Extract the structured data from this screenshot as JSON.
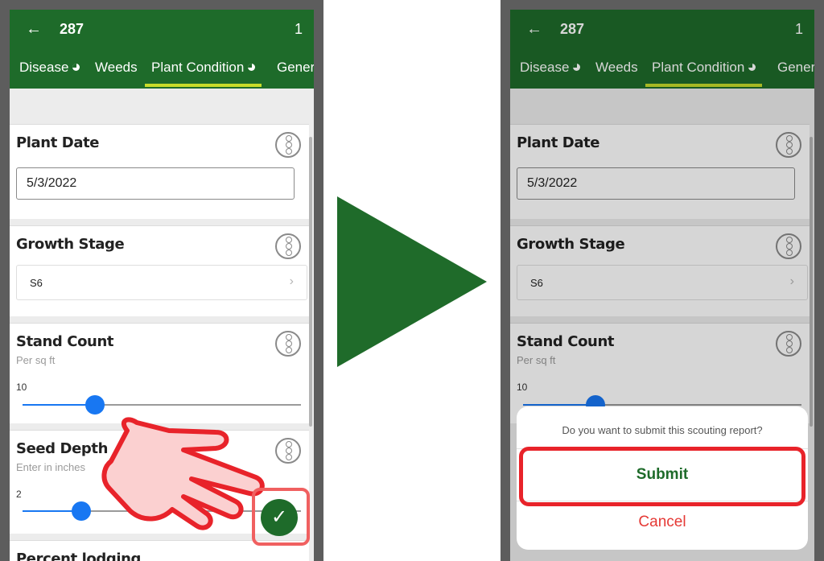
{
  "appbar": {
    "back_icon": "arrow-left-icon",
    "title": "287",
    "count": "1"
  },
  "tabs": [
    "Disease",
    "Weeds",
    "Plant Condition",
    "Gener"
  ],
  "active_tab": "Plant Condition",
  "fields": {
    "plant_date": {
      "label": "Plant Date",
      "value": "5/3/2022"
    },
    "growth_stage": {
      "label": "Growth Stage",
      "value": "S6"
    },
    "stand_count": {
      "label": "Stand Count",
      "hint": "Per sq ft",
      "value": "10"
    },
    "seed_depth": {
      "label": "Seed Depth",
      "hint": "Enter in inches",
      "value": "2"
    },
    "next_partial": {
      "label": "Percent lodging"
    }
  },
  "slider_levels": {
    "stand_count": 0.26,
    "seed_depth": 0.21
  },
  "fab": {
    "icon": "check-icon"
  },
  "dialog": {
    "message": "Do you want to submit this scouting report?",
    "submit_label": "Submit",
    "cancel_label": "Cancel"
  },
  "colors": {
    "brand_green": "#1e6b2a",
    "tab_indicator": "#c8dc2a",
    "slider_blue": "#1877f2",
    "highlight_red": "#e8232a",
    "cancel_red": "#e53935"
  }
}
